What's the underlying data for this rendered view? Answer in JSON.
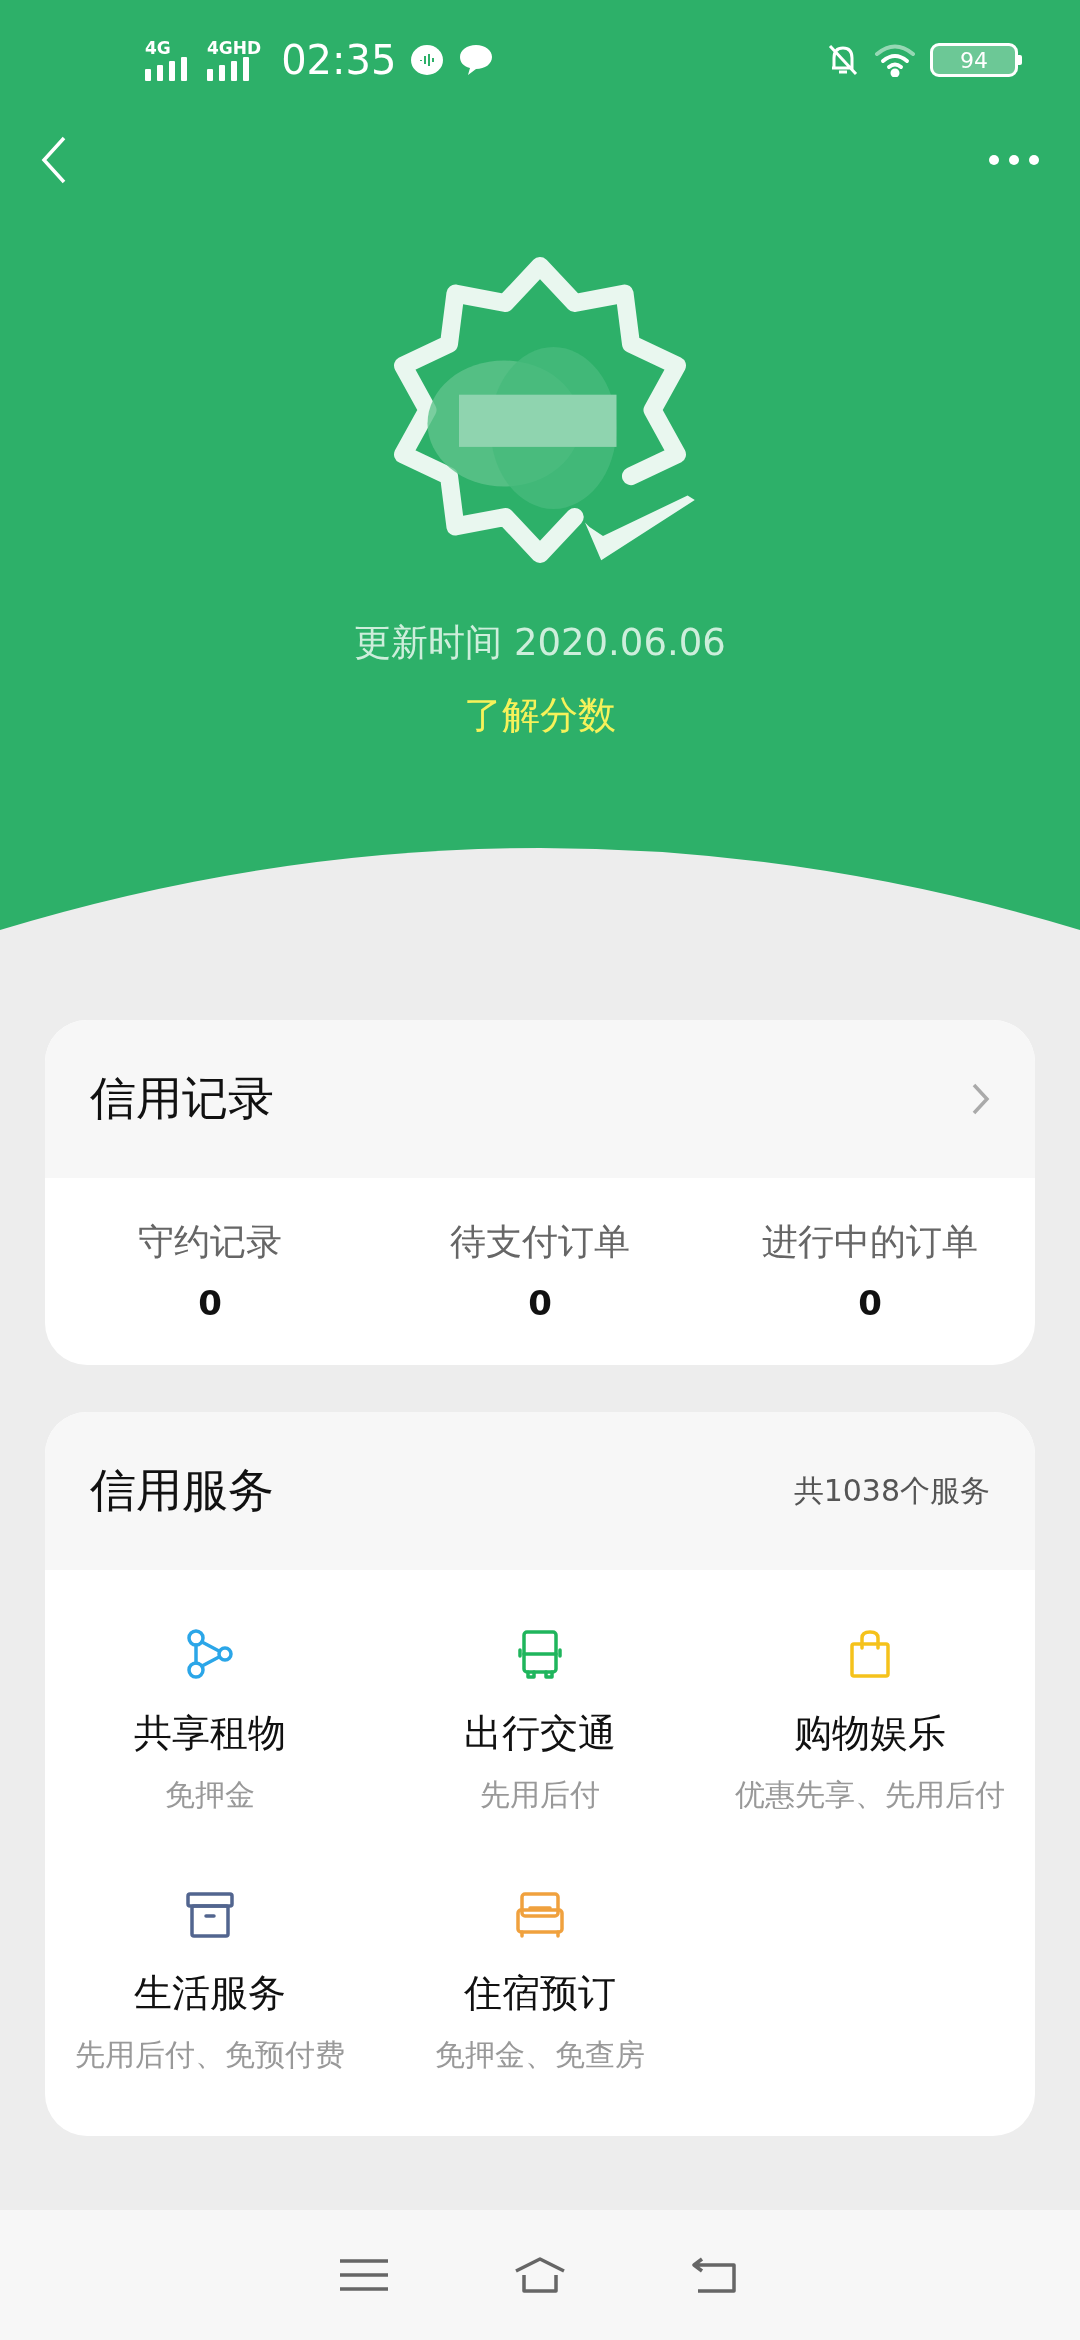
{
  "status_bar": {
    "network_1": "4G",
    "network_2": "4GHD",
    "time": "02:35",
    "battery": "94"
  },
  "header": {
    "updated": "更新时间 2020.06.06",
    "learn_link": "了解分数"
  },
  "credit_record": {
    "title": "信用记录",
    "stats": [
      {
        "label": "守约记录",
        "value": "0"
      },
      {
        "label": "待支付订单",
        "value": "0"
      },
      {
        "label": "进行中的订单",
        "value": "0"
      }
    ]
  },
  "credit_services": {
    "title": "信用服务",
    "count": "共1038个服务",
    "items": [
      {
        "kind": "share",
        "name": "共享租物",
        "desc": "免押金",
        "color": "#2ba6e8"
      },
      {
        "kind": "transit",
        "name": "出行交通",
        "desc": "先用后付",
        "color": "#1fb55c"
      },
      {
        "kind": "shopping",
        "name": "购物娱乐",
        "desc": "优惠先享、先用后付",
        "color": "#f5c21b"
      },
      {
        "kind": "life",
        "name": "生活服务",
        "desc": "先用后付、免预付费",
        "color": "#52658f"
      },
      {
        "kind": "hotel",
        "name": "住宿预订",
        "desc": "免押金、免查房",
        "color": "#f0a13e"
      }
    ]
  }
}
